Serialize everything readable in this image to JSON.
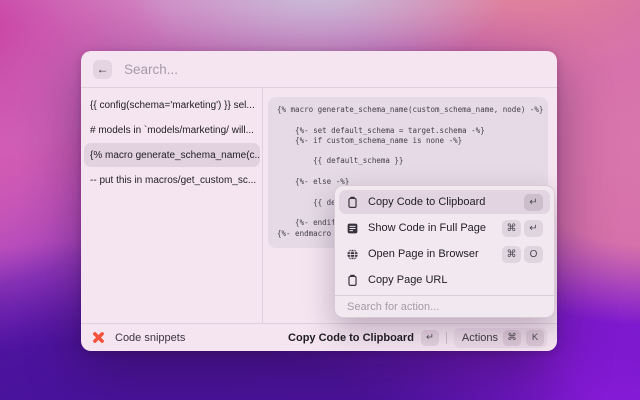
{
  "header": {
    "back_label": "←",
    "search_placeholder": "Search..."
  },
  "sidebar": {
    "items": [
      {
        "label": "{{ config(schema='marketing') }}  sel...",
        "selected": false
      },
      {
        "label": "# models in `models/marketing/ will...",
        "selected": false
      },
      {
        "label": "{% macro generate_schema_name(c...",
        "selected": true
      },
      {
        "label": "-- put this in macros/get_custom_sc...",
        "selected": false
      }
    ]
  },
  "preview": {
    "code": "{% macro generate_schema_name(custom_schema_name, node) -%}\n\n    {%- set default_schema = target.schema -%}\n    {%- if custom_schema_name is none -%}\n\n        {{ default_schema }}\n\n    {%- else -%}\n\n        {{ de\n\n    {%- endif\n{%- endmacro"
  },
  "actions_menu": {
    "items": [
      {
        "icon": "clipboard-icon",
        "label": "Copy Code to Clipboard",
        "keys": [
          "↵"
        ],
        "selected": true
      },
      {
        "icon": "full-page-icon",
        "label": "Show Code in Full Page",
        "keys": [
          "⌘",
          "↵"
        ],
        "selected": false
      },
      {
        "icon": "globe-icon",
        "label": "Open Page in Browser",
        "keys": [
          "⌘",
          "O"
        ],
        "selected": false
      },
      {
        "icon": "clipboard-icon",
        "label": "Copy Page URL",
        "keys": [],
        "selected": false
      }
    ],
    "search_placeholder": "Search for action..."
  },
  "footer": {
    "app_icon": "dbt-logo-icon",
    "app_name": "Code snippets",
    "primary_action_label": "Copy Code to Clipboard",
    "primary_action_key": "↵",
    "actions_label": "Actions",
    "actions_keys": [
      "⌘",
      "K"
    ]
  },
  "colors": {
    "accent_orange": "#f4533b",
    "window_bg": "#f4e5f0",
    "code_block_bg": "#e5dae5",
    "selection_bg": "#e2d2df",
    "popup_bg": "#f1e8f0"
  }
}
